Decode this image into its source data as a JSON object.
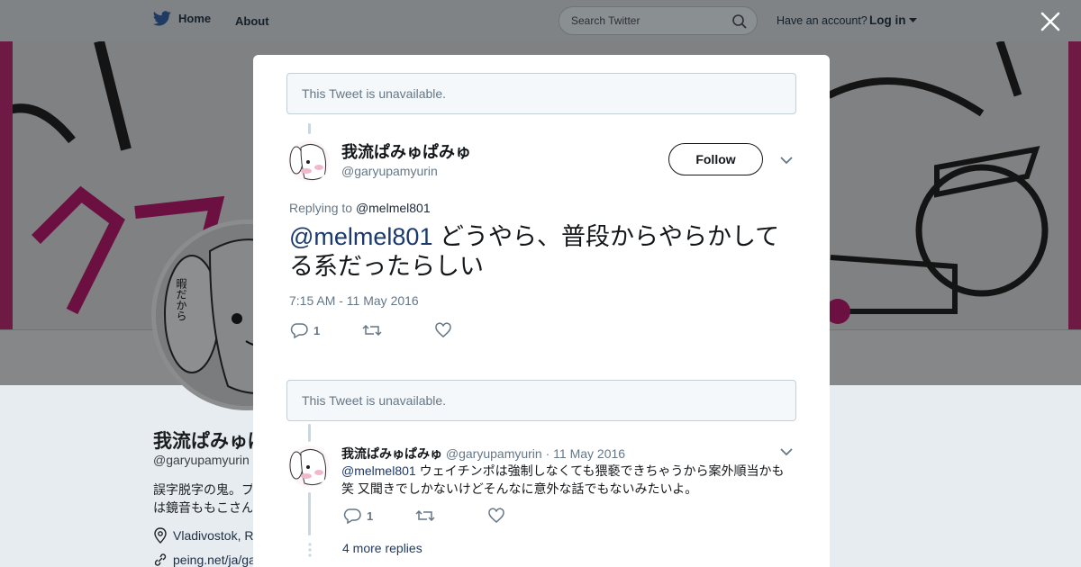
{
  "topbar": {
    "home_label": "Home",
    "about_label": "About",
    "search_placeholder": "Search Twitter",
    "account_prompt": "Have an account?",
    "login_label": "Log in"
  },
  "background_profile": {
    "name": "我流ぱみゅぱみゅ",
    "handle": "@garyupamyurin",
    "bio": "誤字脱字の鬼。プ\nは鏡音ももこさん",
    "location": "Vladivostok, R",
    "link": "peing.net/ja/ga"
  },
  "modal": {
    "unavailable_top": "This Tweet is unavailable.",
    "tweet": {
      "name": "我流ぱみゅぱみゅ",
      "handle": "@garyupamyurin",
      "follow_label": "Follow",
      "replying_prefix": "Replying to",
      "replying_to": "@melmel801",
      "mention": "@melmel801",
      "text": " どうやら、普段からやらかしてる系だったらしい",
      "timestamp": "7:15 AM - 11 May 2016",
      "reply_count": "1"
    },
    "unavailable_bottom": "This Tweet is unavailable.",
    "reply": {
      "name": "我流ぱみゅぱみゅ",
      "handle": "@garyupamyurin",
      "date": "· 11 May 2016",
      "mention": "@melmel801",
      "text": " ウェイチンポは強制しなくても猥褻できちゃうから案外順当かも笑 又聞きでしかないけどそんなに意外な話でもないみたいよ。",
      "reply_count": "1"
    },
    "more_replies": "4 more replies"
  },
  "colors": {
    "accent": "#1da1f2",
    "link": "#1b3a6b",
    "muted": "#657786",
    "overlay": "#7f8385"
  }
}
